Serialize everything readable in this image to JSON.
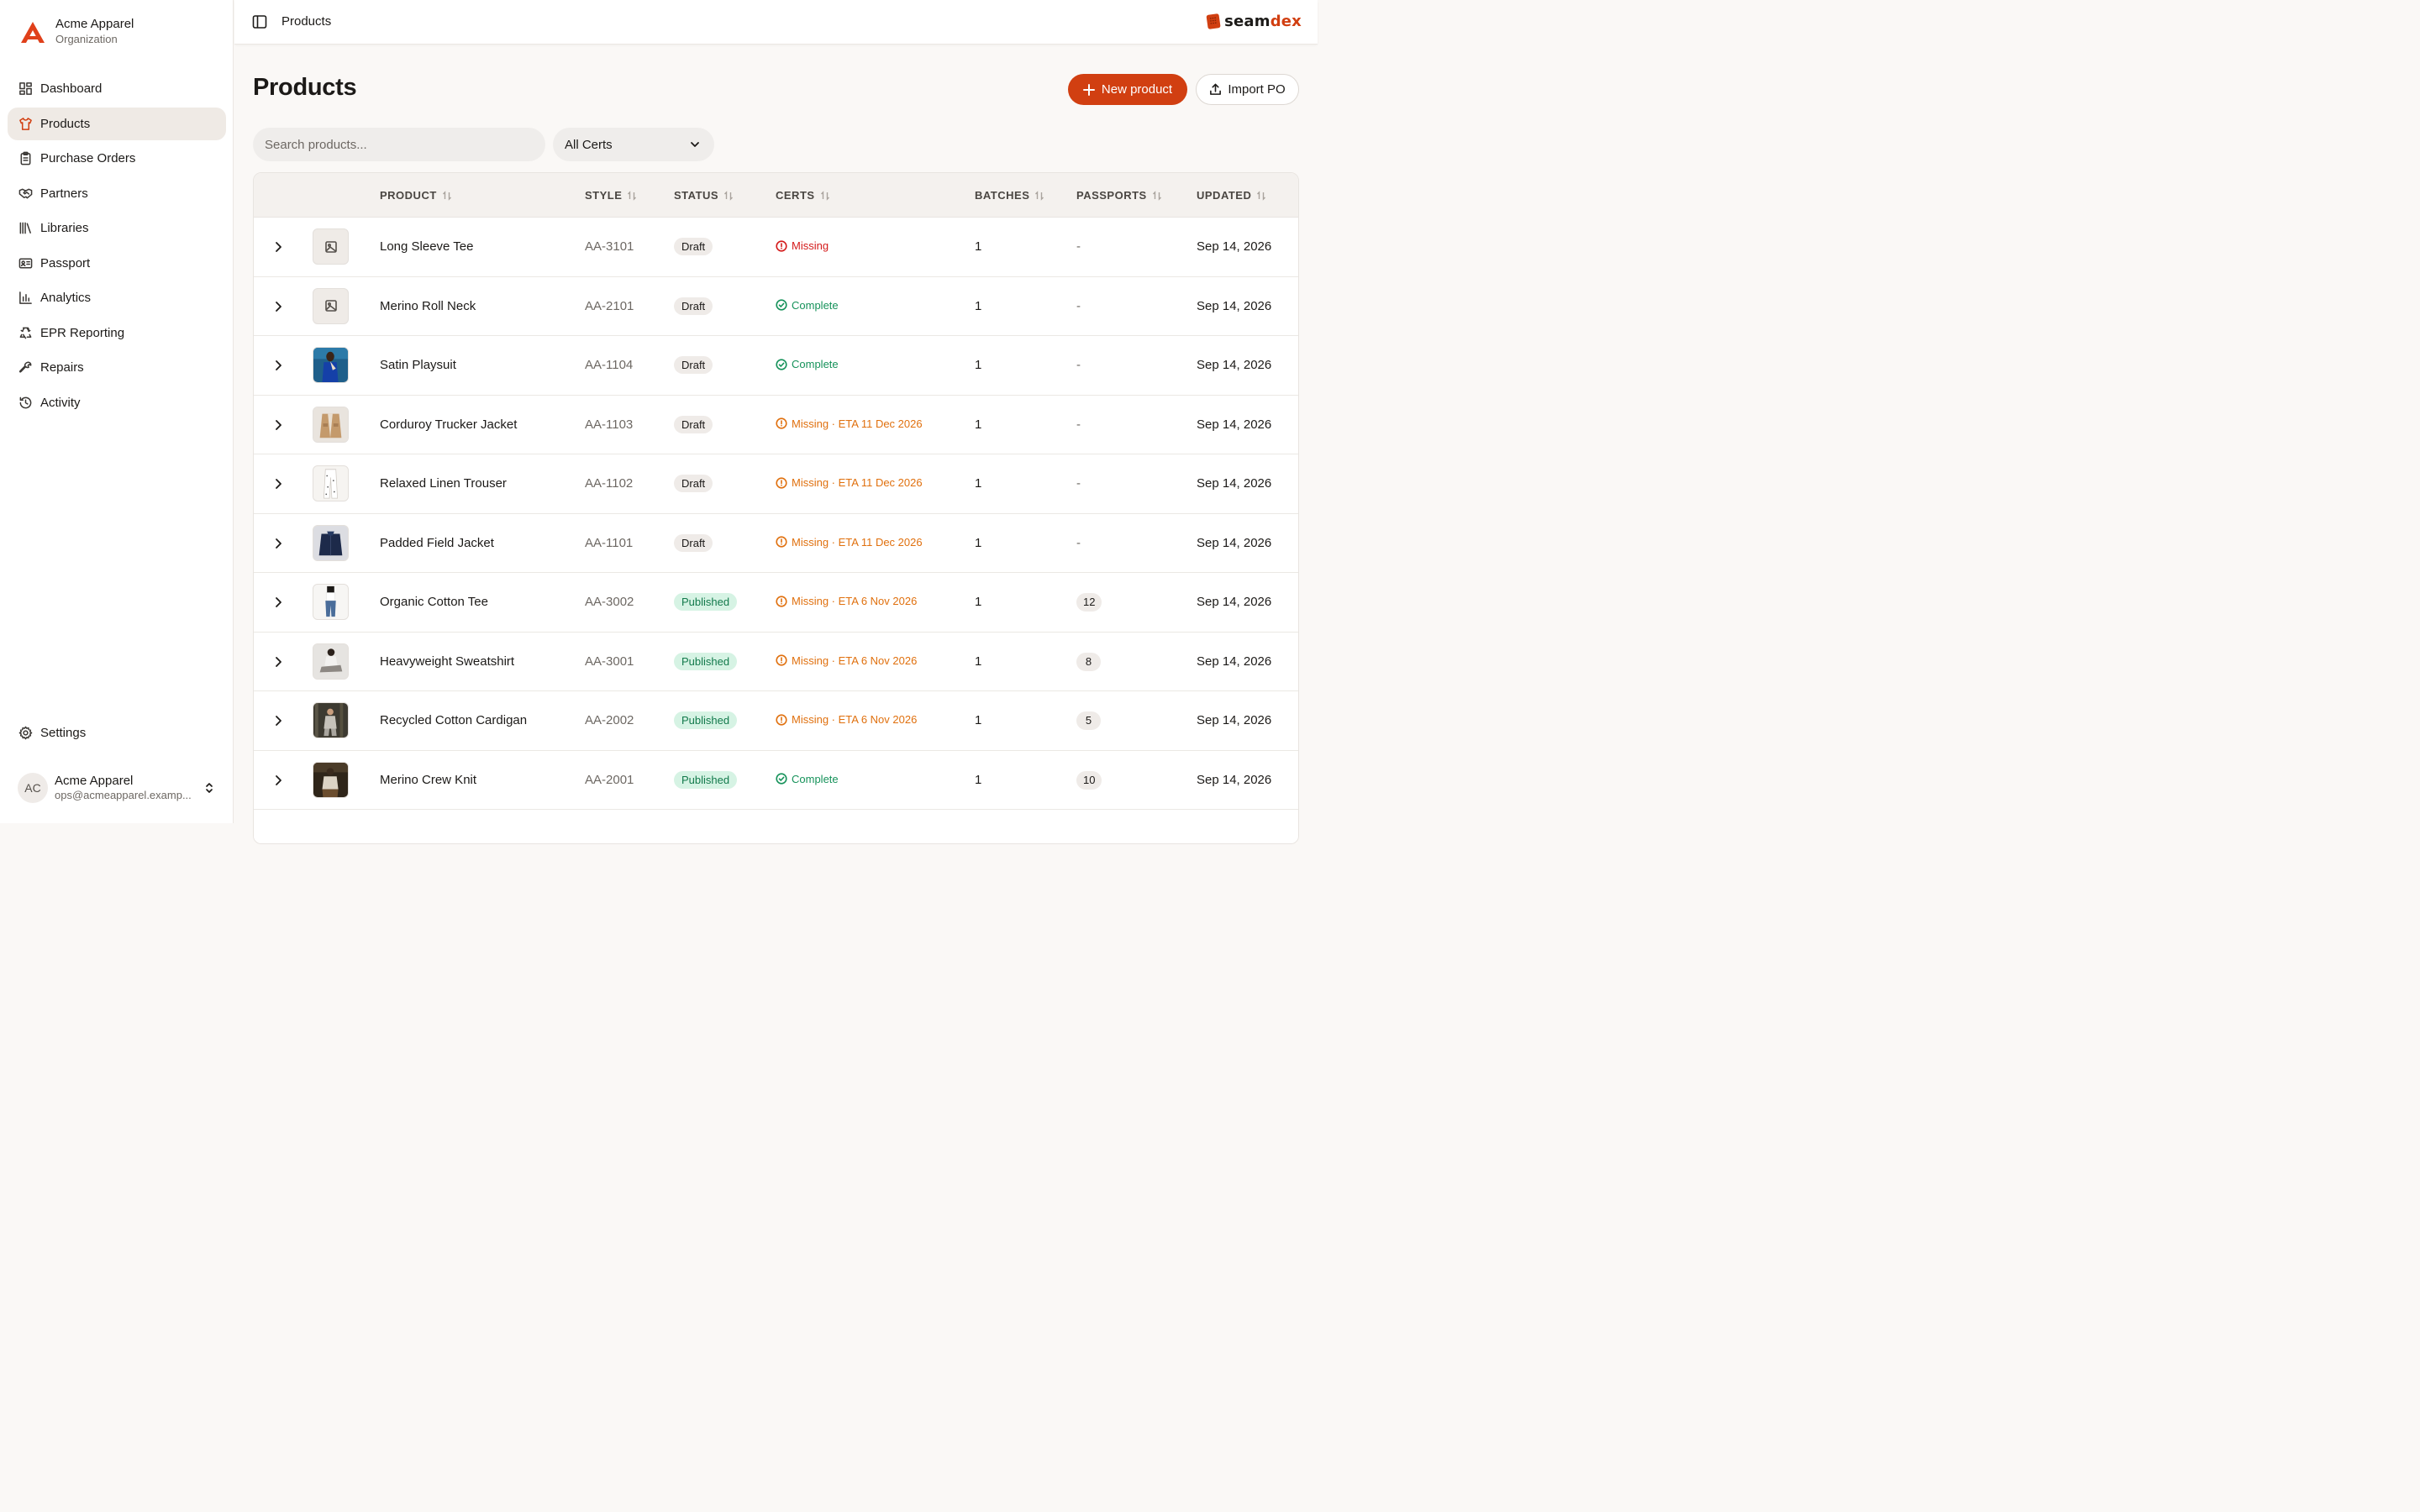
{
  "org": {
    "name": "Acme Apparel",
    "subtitle": "Organization"
  },
  "nav": [
    {
      "label": "Dashboard",
      "icon": "dashboard-icon",
      "active": false
    },
    {
      "label": "Products",
      "icon": "shirt-icon",
      "active": true
    },
    {
      "label": "Purchase Orders",
      "icon": "clipboard-icon",
      "active": false
    },
    {
      "label": "Partners",
      "icon": "handshake-icon",
      "active": false
    },
    {
      "label": "Libraries",
      "icon": "library-icon",
      "active": false
    },
    {
      "label": "Passport",
      "icon": "id-card-icon",
      "active": false
    },
    {
      "label": "Analytics",
      "icon": "bar-chart-icon",
      "active": false
    },
    {
      "label": "EPR Reporting",
      "icon": "recycle-icon",
      "active": false
    },
    {
      "label": "Repairs",
      "icon": "wrench-icon",
      "active": false
    },
    {
      "label": "Activity",
      "icon": "history-icon",
      "active": false
    }
  ],
  "settings": {
    "label": "Settings"
  },
  "user": {
    "initials": "AC",
    "name": "Acme Apparel",
    "email": "ops@acmeapparel.examp..."
  },
  "topbar": {
    "breadcrumb": "Products",
    "brand_part1": "seam",
    "brand_part2": "dex"
  },
  "page": {
    "title": "Products",
    "new_button": "New product",
    "import_button": "Import PO"
  },
  "filters": {
    "search_placeholder": "Search products...",
    "cert_filter": "All Certs"
  },
  "colors": {
    "accent": "#d13f11",
    "draft_bg": "#efebe8",
    "published_bg": "#d6f3e4",
    "missing": "#d41a1a",
    "complete": "#16925a",
    "eta": "#e0700e"
  },
  "table": {
    "columns": {
      "product": "PRODUCT",
      "style": "STYLE",
      "status": "STATUS",
      "certs": "CERTS",
      "batches": "BATCHES",
      "passports": "PASSPORTS",
      "updated": "UPDATED"
    },
    "rows": [
      {
        "name": "Long Sleeve Tee",
        "style": "AA-3101",
        "status": "Draft",
        "cert": "Missing",
        "cert_tone": "red",
        "batches": "1",
        "passports": "-",
        "updated": "Sep 14, 2026",
        "thumb": "placeholder"
      },
      {
        "name": "Merino Roll Neck",
        "style": "AA-2101",
        "status": "Draft",
        "cert": "Complete",
        "cert_tone": "green",
        "batches": "1",
        "passports": "-",
        "updated": "Sep 14, 2026",
        "thumb": "placeholder"
      },
      {
        "name": "Satin Playsuit",
        "style": "AA-1104",
        "status": "Draft",
        "cert": "Complete",
        "cert_tone": "green",
        "batches": "1",
        "passports": "-",
        "updated": "Sep 14, 2026",
        "thumb": "blue"
      },
      {
        "name": "Corduroy Trucker Jacket",
        "style": "AA-1103",
        "status": "Draft",
        "cert": "Missing · ETA 11 Dec 2026",
        "cert_tone": "orange",
        "batches": "1",
        "passports": "-",
        "updated": "Sep 14, 2026",
        "thumb": "tan"
      },
      {
        "name": "Relaxed Linen Trouser",
        "style": "AA-1102",
        "status": "Draft",
        "cert": "Missing · ETA 11 Dec 2026",
        "cert_tone": "orange",
        "batches": "1",
        "passports": "-",
        "updated": "Sep 14, 2026",
        "thumb": "white"
      },
      {
        "name": "Padded Field Jacket",
        "style": "AA-1101",
        "status": "Draft",
        "cert": "Missing · ETA 11 Dec 2026",
        "cert_tone": "orange",
        "batches": "1",
        "passports": "-",
        "updated": "Sep 14, 2026",
        "thumb": "navy"
      },
      {
        "name": "Organic Cotton Tee",
        "style": "AA-3002",
        "status": "Published",
        "cert": "Missing · ETA 6 Nov 2026",
        "cert_tone": "orange",
        "batches": "1",
        "passports": "12",
        "updated": "Sep 14, 2026",
        "thumb": "denim"
      },
      {
        "name": "Heavyweight Sweatshirt",
        "style": "AA-3001",
        "status": "Published",
        "cert": "Missing · ETA 6 Nov 2026",
        "cert_tone": "orange",
        "batches": "1",
        "passports": "8",
        "updated": "Sep 14, 2026",
        "thumb": "grey"
      },
      {
        "name": "Recycled Cotton Cardigan",
        "style": "AA-2002",
        "status": "Published",
        "cert": "Missing · ETA 6 Nov 2026",
        "cert_tone": "orange",
        "batches": "1",
        "passports": "5",
        "updated": "Sep 14, 2026",
        "thumb": "forest"
      },
      {
        "name": "Merino Crew Knit",
        "style": "AA-2001",
        "status": "Published",
        "cert": "Complete",
        "cert_tone": "green",
        "batches": "1",
        "passports": "10",
        "updated": "Sep 14, 2026",
        "thumb": "brown"
      }
    ]
  }
}
